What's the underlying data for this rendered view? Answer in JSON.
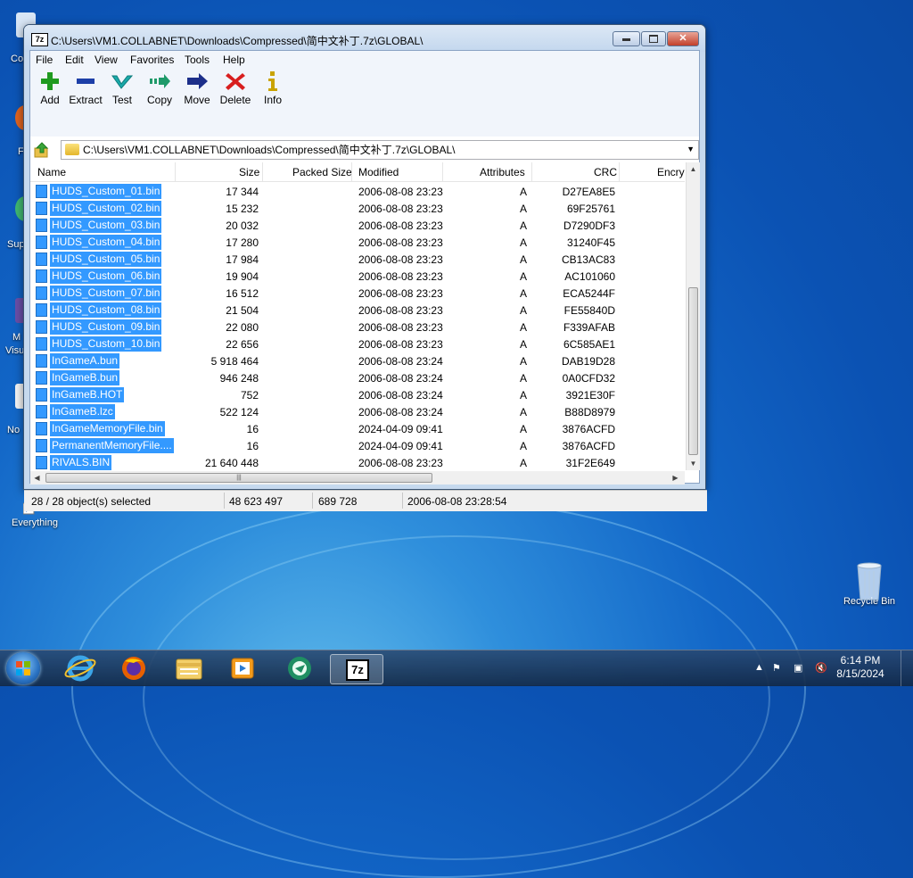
{
  "window": {
    "title": "C:\\Users\\VM1.COLLABNET\\Downloads\\Compressed\\简中文补丁.7z\\GLOBAL\\",
    "app_logo": "7z",
    "minimize_icon": "minimize-icon",
    "maximize_icon": "maximize-icon",
    "close_icon": "close-icon"
  },
  "menu": [
    "File",
    "Edit",
    "View",
    "Favorites",
    "Tools",
    "Help"
  ],
  "toolbar": [
    {
      "label": "Add",
      "icon": "plus-icon",
      "color": "#1f9a1f"
    },
    {
      "label": "Extract",
      "icon": "minus-icon",
      "color": "#1d3fa8"
    },
    {
      "label": "Test",
      "icon": "check-icon",
      "color": "#1aa9a9"
    },
    {
      "label": "Copy",
      "icon": "copy-arrow-icon",
      "color": "#1f9a6a"
    },
    {
      "label": "Move",
      "icon": "move-arrow-icon",
      "color": "#1d2f8a"
    },
    {
      "label": "Delete",
      "icon": "x-icon",
      "color": "#d81e1e"
    },
    {
      "label": "Info",
      "icon": "info-icon",
      "color": "#c9a300"
    }
  ],
  "address": {
    "path": "C:\\Users\\VM1.COLLABNET\\Downloads\\Compressed\\简中文补丁.7z\\GLOBAL\\",
    "up_icon": "up-arrow-icon",
    "folder_icon": "folder-icon"
  },
  "columns": [
    "Name",
    "Size",
    "Packed Size",
    "Modified",
    "Attributes",
    "CRC",
    "Encry"
  ],
  "files": [
    {
      "name": "HUDS_Custom_01.bin",
      "size": "17 344",
      "packed": "",
      "modified": "2006-08-08 23:23",
      "attr": "A",
      "crc": "D27EA8E5"
    },
    {
      "name": "HUDS_Custom_02.bin",
      "size": "15 232",
      "packed": "",
      "modified": "2006-08-08 23:23",
      "attr": "A",
      "crc": "69F25761"
    },
    {
      "name": "HUDS_Custom_03.bin",
      "size": "20 032",
      "packed": "",
      "modified": "2006-08-08 23:23",
      "attr": "A",
      "crc": "D7290DF3"
    },
    {
      "name": "HUDS_Custom_04.bin",
      "size": "17 280",
      "packed": "",
      "modified": "2006-08-08 23:23",
      "attr": "A",
      "crc": "31240F45"
    },
    {
      "name": "HUDS_Custom_05.bin",
      "size": "17 984",
      "packed": "",
      "modified": "2006-08-08 23:23",
      "attr": "A",
      "crc": "CB13AC83"
    },
    {
      "name": "HUDS_Custom_06.bin",
      "size": "19 904",
      "packed": "",
      "modified": "2006-08-08 23:23",
      "attr": "A",
      "crc": "AC101060"
    },
    {
      "name": "HUDS_Custom_07.bin",
      "size": "16 512",
      "packed": "",
      "modified": "2006-08-08 23:23",
      "attr": "A",
      "crc": "ECA5244F"
    },
    {
      "name": "HUDS_Custom_08.bin",
      "size": "21 504",
      "packed": "",
      "modified": "2006-08-08 23:23",
      "attr": "A",
      "crc": "FE55840D"
    },
    {
      "name": "HUDS_Custom_09.bin",
      "size": "22 080",
      "packed": "",
      "modified": "2006-08-08 23:23",
      "attr": "A",
      "crc": "F339AFAB"
    },
    {
      "name": "HUDS_Custom_10.bin",
      "size": "22 656",
      "packed": "",
      "modified": "2006-08-08 23:23",
      "attr": "A",
      "crc": "6C585AE1"
    },
    {
      "name": "InGameA.bun",
      "size": "5 918 464",
      "packed": "",
      "modified": "2006-08-08 23:24",
      "attr": "A",
      "crc": "DAB19D28"
    },
    {
      "name": "InGameB.bun",
      "size": "946 248",
      "packed": "",
      "modified": "2006-08-08 23:24",
      "attr": "A",
      "crc": "0A0CFD32"
    },
    {
      "name": "InGameB.HOT",
      "size": "752",
      "packed": "",
      "modified": "2006-08-08 23:24",
      "attr": "A",
      "crc": "3921E30F"
    },
    {
      "name": "InGameB.lzc",
      "size": "522 124",
      "packed": "",
      "modified": "2006-08-08 23:24",
      "attr": "A",
      "crc": "B88D8979"
    },
    {
      "name": "InGameMemoryFile.bin",
      "size": "16",
      "packed": "",
      "modified": "2024-04-09 09:41",
      "attr": "A",
      "crc": "3876ACFD"
    },
    {
      "name": "PermanentMemoryFile....",
      "size": "16",
      "packed": "",
      "modified": "2024-04-09 09:41",
      "attr": "A",
      "crc": "3876ACFD"
    },
    {
      "name": "RIVALS.BIN",
      "size": "21 640 448",
      "packed": "",
      "modified": "2006-08-08 23:23",
      "attr": "A",
      "crc": "31F2E649"
    }
  ],
  "status": {
    "selection": "28 / 28 object(s) selected",
    "total_size": "48 623 497",
    "packed_size": "689 728",
    "modified": "2006-08-08 23:28:54"
  },
  "desktop": {
    "icons": [
      {
        "label": "Everything",
        "icon": "everything-icon"
      },
      {
        "label": "Recycle Bin",
        "icon": "recycle-bin-icon"
      }
    ],
    "partial_labels": [
      "Co",
      "F",
      "Sup",
      "M",
      "Visu",
      "No"
    ]
  },
  "taskbar": {
    "items": [
      "internet-explorer-icon",
      "firefox-icon",
      "file-explorer-icon",
      "media-player-icon",
      "app-icon",
      "7zip-icon"
    ],
    "clock_time": "6:14 PM",
    "clock_date": "8/15/2024"
  },
  "colors": {
    "selection": "#3399ff",
    "window_frame": "#c6d9ee",
    "desktop": "#1266c7"
  }
}
